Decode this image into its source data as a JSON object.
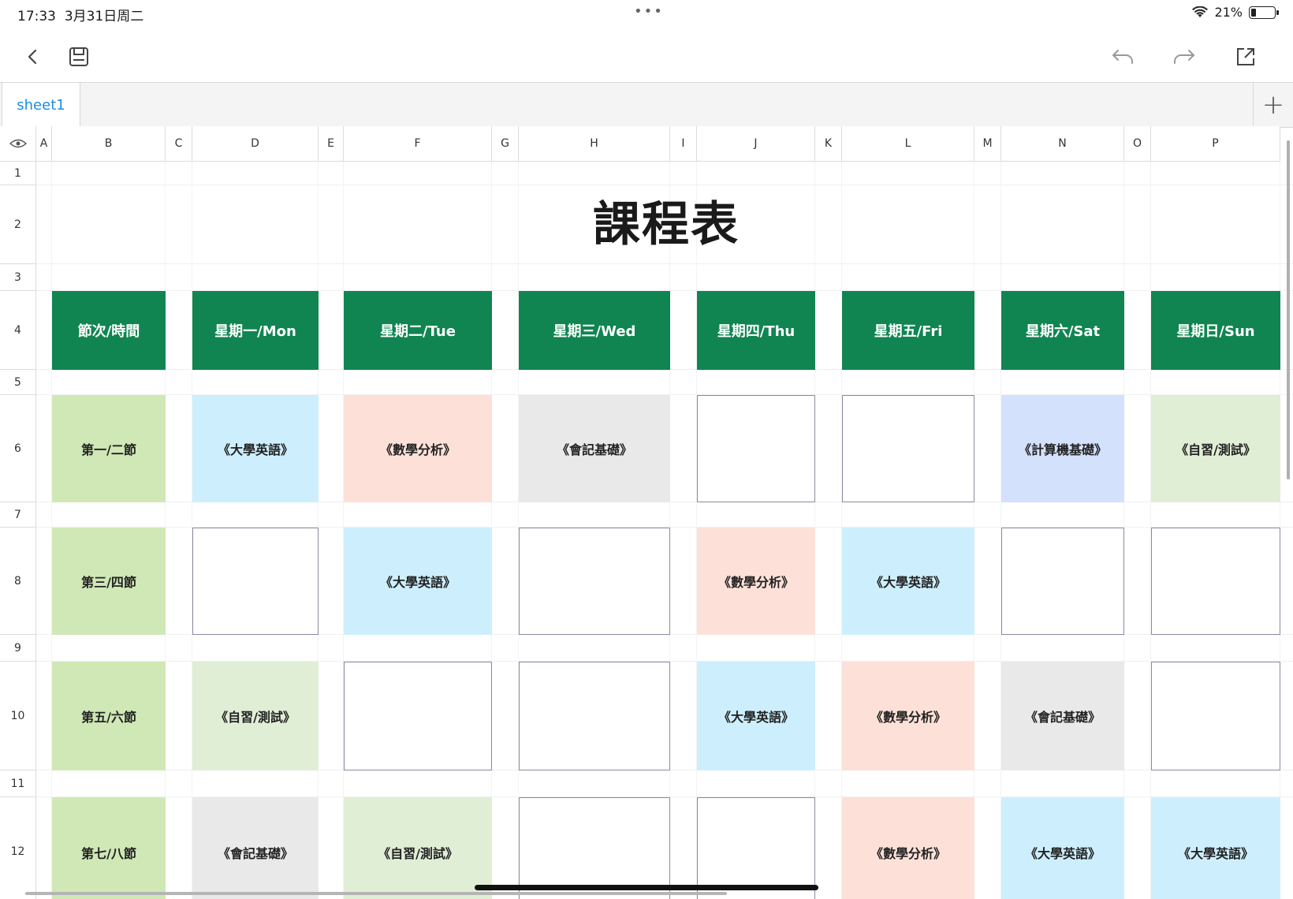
{
  "status": {
    "time": "17:33",
    "date": "3月31日周二",
    "battery": "21%",
    "battery_level": 0.21
  },
  "toolbar": {
    "back_icon": "chevron-left-icon",
    "save_icon": "save-icon",
    "undo_icon": "undo-icon",
    "redo_icon": "redo-icon",
    "share_icon": "share-icon"
  },
  "tabs": {
    "sheet1": "sheet1",
    "add": "+"
  },
  "columns": [
    "A",
    "B",
    "C",
    "D",
    "E",
    "F",
    "G",
    "H",
    "I",
    "J",
    "K",
    "L",
    "M",
    "N",
    "O",
    "P"
  ],
  "rows": [
    "1",
    "2",
    "3",
    "4",
    "5",
    "6",
    "7",
    "8",
    "9",
    "10",
    "11",
    "12"
  ],
  "title": "課程表",
  "headers": [
    "節次/時間",
    "星期一/Mon",
    "星期二/Tue",
    "星期三/Wed",
    "星期四/Thu",
    "星期五/Fri",
    "星期六/Sat",
    "星期日/Sun"
  ],
  "periods": [
    "第一/二節",
    "第三/四節",
    "第五/六節",
    "第七/八節"
  ],
  "schedule": [
    [
      "《大學英語》",
      "《數學分析》",
      "《會記基礎》",
      "",
      "",
      "《計算機基礎》",
      "《自習/測試》"
    ],
    [
      "",
      "《大學英語》",
      "",
      "《數學分析》",
      "《大學英語》",
      "",
      ""
    ],
    [
      "《自習/測試》",
      "",
      "",
      "《大學英語》",
      "《數學分析》",
      "《會記基礎》",
      ""
    ],
    [
      "《會記基礎》",
      "《自習/測試》",
      "",
      "",
      "《數學分析》",
      "《大學英語》",
      "《大學英語》"
    ]
  ],
  "colors": {
    "header": "#108552",
    "period": "#cfe8b6",
    "english": "#cdeffd",
    "math": "#fde1d8",
    "accounting": "#e9e9e9",
    "computer": "#d3e1fd",
    "self_study": "#e0eed6"
  }
}
